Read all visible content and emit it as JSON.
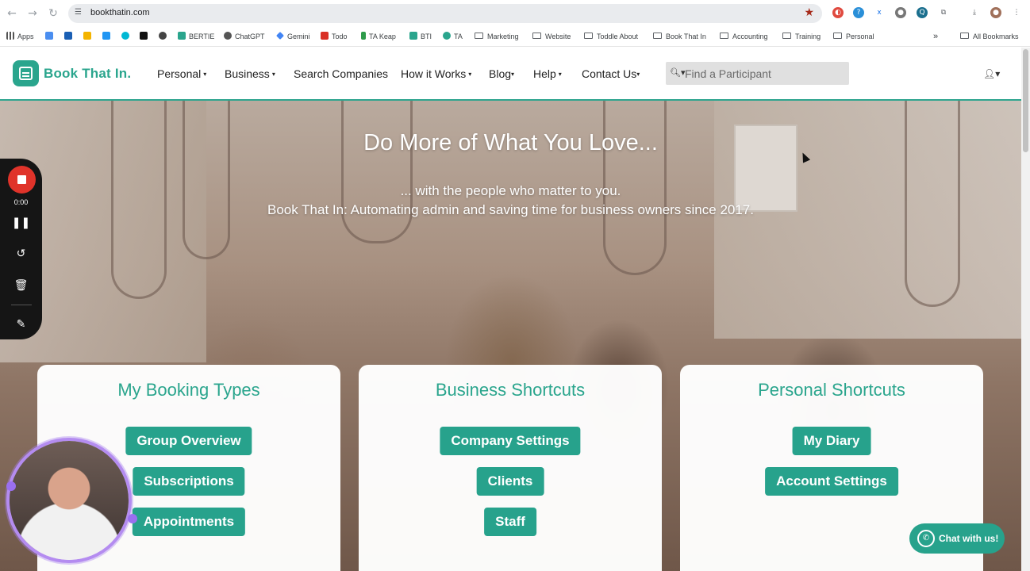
{
  "browser": {
    "url": "bookthatin.com",
    "back_icon": "arrow-left",
    "forward_icon": "arrow-right",
    "reload_icon": "reload"
  },
  "bookmarks": {
    "apps": "Apps",
    "items": [
      "BERTIE",
      "ChatGPT",
      "Gemini",
      "Todo",
      "TA Keap",
      "BTI",
      "TA"
    ],
    "folders": [
      "Marketing",
      "Website",
      "Toddle About",
      "Book That In",
      "Accounting",
      "Training",
      "Personal"
    ],
    "more": "»",
    "all": "All Bookmarks"
  },
  "site": {
    "logo_text": "Book That In.",
    "menu": [
      {
        "label": "Personal",
        "caret": "▾"
      },
      {
        "label": "Business",
        "caret": "▾"
      },
      {
        "label": "Search Companies",
        "caret": ""
      },
      {
        "label": "How it Works",
        "caret": "▾"
      },
      {
        "label": "Blog",
        "caret": "▾"
      },
      {
        "label": "Help",
        "caret": "▾"
      },
      {
        "label": "Contact Us",
        "caret": "▾"
      }
    ],
    "search_placeholder": "Find a Participant",
    "user_icon": "user-icon"
  },
  "hero": {
    "title": "Do More of What You Love...",
    "subtitle_1": "... with the people who matter to you.",
    "subtitle_2": "Book That In: Automating admin and saving time for business owners since 2017."
  },
  "cards": [
    {
      "title": "My Booking Types",
      "buttons": [
        "Group Overview",
        "Subscriptions",
        "Appointments"
      ]
    },
    {
      "title": "Business Shortcuts",
      "buttons": [
        "Company Settings",
        "Clients",
        "Staff"
      ]
    },
    {
      "title": "Personal Shortcuts",
      "buttons": [
        "My Diary",
        "Account Settings"
      ]
    }
  ],
  "recorder": {
    "time": "0:00"
  },
  "chat": {
    "label": "Chat with us!"
  },
  "colors": {
    "brand": "#2aa58d",
    "record": "#e0332a"
  }
}
